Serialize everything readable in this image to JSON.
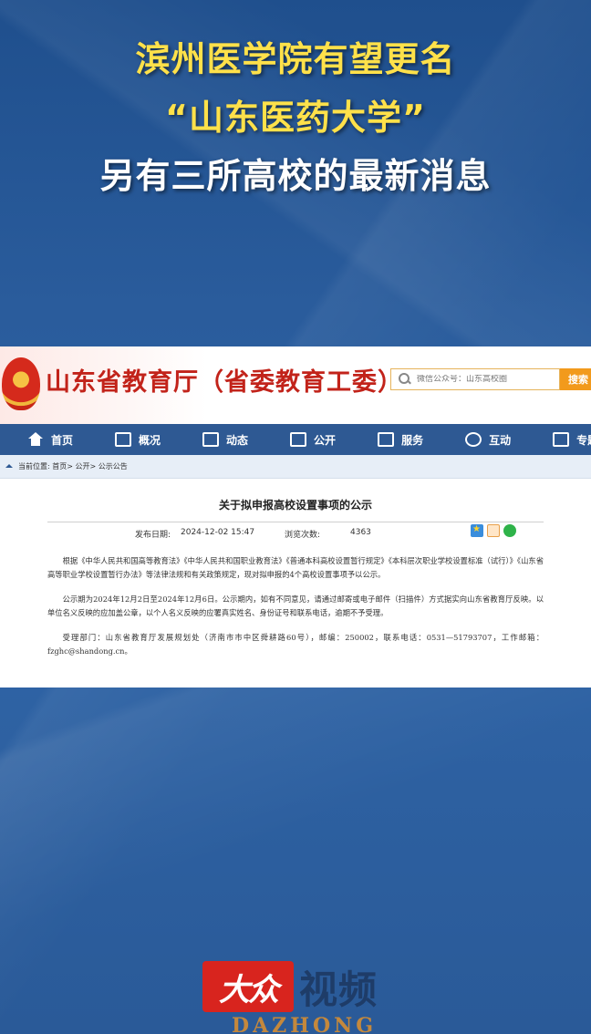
{
  "headline": {
    "line1": "滨州医学院有望更名",
    "line2": "“山东医药大学”",
    "line3": "另有三所高校的最新消息"
  },
  "site": {
    "title": "山东省教育厅（省委教育工委）",
    "search_placeholder": "微信公众号：山东高校圈",
    "search_button": "搜索"
  },
  "nav": {
    "items": [
      {
        "label": "首页",
        "icon": "home-icon"
      },
      {
        "label": "概况",
        "icon": "overview-icon"
      },
      {
        "label": "动态",
        "icon": "news-icon"
      },
      {
        "label": "公开",
        "icon": "book-icon"
      },
      {
        "label": "服务",
        "icon": "service-icon"
      },
      {
        "label": "互动",
        "icon": "chat-icon"
      },
      {
        "label": "专题",
        "icon": "topic-icon"
      }
    ]
  },
  "breadcrumb": {
    "text": "当前位置: 首页> 公开> 公示公告"
  },
  "article": {
    "title": "关于拟申报高校设置事项的公示",
    "date_label": "发布日期:",
    "date": "2024-12-02 15:47",
    "views_label": "浏览次数:",
    "views": "4363",
    "para1": "根据《中华人民共和国高等教育法》《中华人民共和国职业教育法》《普通本科高校设置暂行规定》《本科层次职业学校设置标准（试行）》《山东省高等职业学校设置暂行办法》等法律法规和有关政策规定，现对拟申报的4个高校设置事项予以公示。",
    "para2": "公示期为2024年12月2日至2024年12月6日。公示期内，如有不同意见，请通过邮寄或电子邮件（扫描件）方式据实向山东省教育厅反映。以单位名义反映的应加盖公章，以个人名义反映的应署真实姓名、身份证号和联系电话，逾期不予受理。",
    "para3": "受理部门：山东省教育厅发展规划处（济南市市中区舜耕路60号），邮编：250002，联系电话：0531—51793707，工作邮箱：fzghc@shandong.cn。"
  },
  "logo": {
    "badge": "大众",
    "text": "视频",
    "sub": "DAZHONG"
  }
}
